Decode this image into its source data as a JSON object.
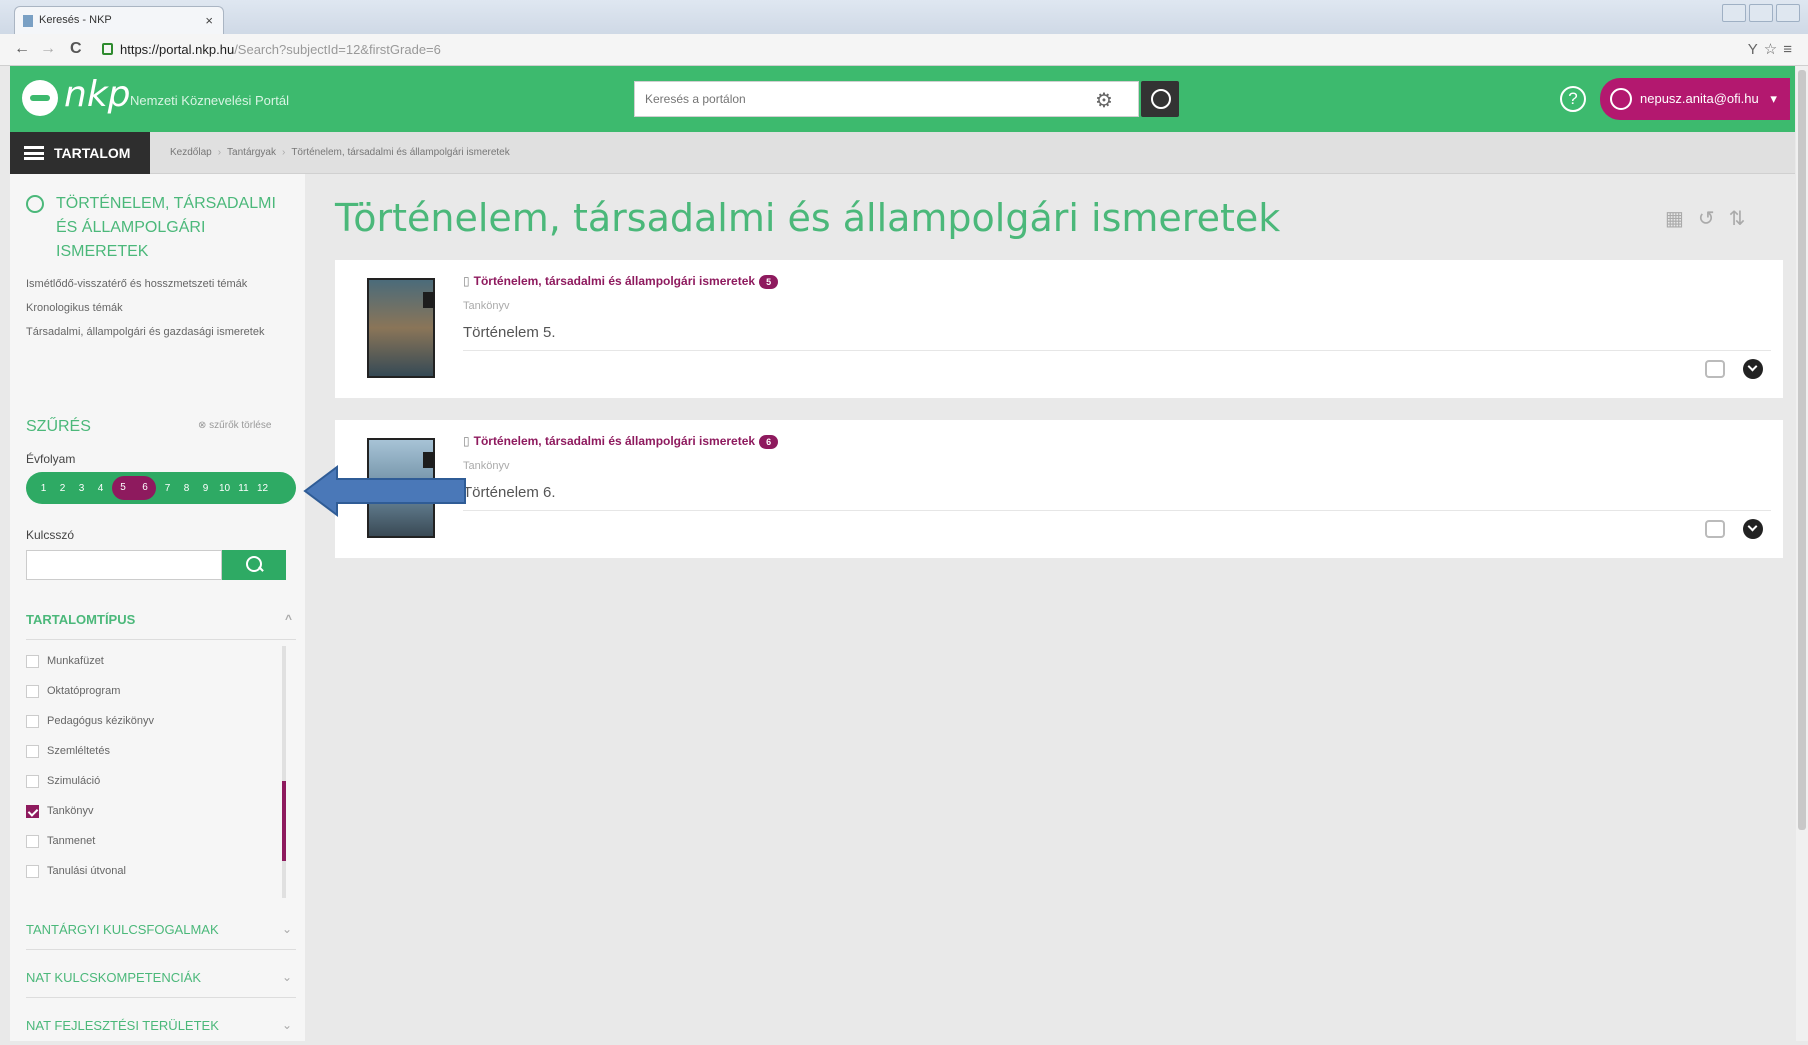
{
  "browser": {
    "tab_title": "Keresés - NKP",
    "tab_close": "×",
    "url_host": "https://portal.nkp.hu",
    "url_path": "/Search?subjectId=12&firstGrade=6",
    "back": "←",
    "forward": "→",
    "reload": "C",
    "right_icons": "Y☆≡"
  },
  "header": {
    "logo": "nkp",
    "logo_subtitle": "Nemzeti Köznevelési Portál",
    "search_placeholder": "Keresés a portálon",
    "help": "?",
    "user": "nepusz.anita@ofi.hu",
    "user_caret": "▾"
  },
  "crumbbar": {
    "menu_label": "TARTALOM",
    "crumbs": [
      "Kezdőlap",
      "Tantárgyak",
      "Történelem, társadalmi és állampolgári ismeretek"
    ],
    "sep": "›"
  },
  "sidebar": {
    "subject": "TÖRTÉNELEM, TÁRSADALMI ÉS ÁLLAMPOLGÁRI ISMERETEK",
    "topics": [
      "Ismétlődő-visszatérő és hosszmetszeti témák",
      "Kronologikus témák",
      "Társadalmi, állampolgári és gazdasági ismeretek"
    ],
    "filter_title": "SZŰRÉS",
    "filter_clear": "szűrők törlése",
    "grade_label": "Évfolyam",
    "grades": [
      "1",
      "2",
      "3",
      "4",
      "5",
      "6",
      "7",
      "8",
      "9",
      "10",
      "11",
      "12"
    ],
    "keyword_label": "Kulcsszó",
    "content_type_title": "TARTALOMTÍPUS",
    "content_type_chevron": "^",
    "content_types": [
      {
        "label": "Munkafüzet",
        "checked": false
      },
      {
        "label": "Oktatóprogram",
        "checked": false
      },
      {
        "label": "Pedagógus kézikönyv",
        "checked": false
      },
      {
        "label": "Szemléltetés",
        "checked": false
      },
      {
        "label": "Szimuláció",
        "checked": false
      },
      {
        "label": "Tankönyv",
        "checked": true
      },
      {
        "label": "Tanmenet",
        "checked": false
      },
      {
        "label": "Tanulási útvonal",
        "checked": false
      }
    ],
    "sections": [
      {
        "label": "TANTÁRGYI KULCSFOGALMAK",
        "chevron": "⌄"
      },
      {
        "label": "NAT KULCSKOMPETENCIÁK",
        "chevron": "⌄"
      },
      {
        "label": "NAT FEJLESZTÉSI TERÜLETEK",
        "chevron": "⌄"
      }
    ]
  },
  "main": {
    "title": "Történelem, társadalmi és állampolgári ismeretek",
    "results": [
      {
        "subject": "Történelem, társadalmi és állampolgári ismeretek",
        "grade": "5",
        "type": "Tankönyv",
        "name": "Történelem 5."
      },
      {
        "subject": "Történelem, társadalmi és állampolgári ismeretek",
        "grade": "6",
        "type": "Tankönyv",
        "name": "Történelem 6."
      }
    ]
  },
  "colors": {
    "brand_green": "#3dba6e",
    "accent_purple": "#8e1a5e",
    "arrow_blue": "#4a78b8"
  }
}
